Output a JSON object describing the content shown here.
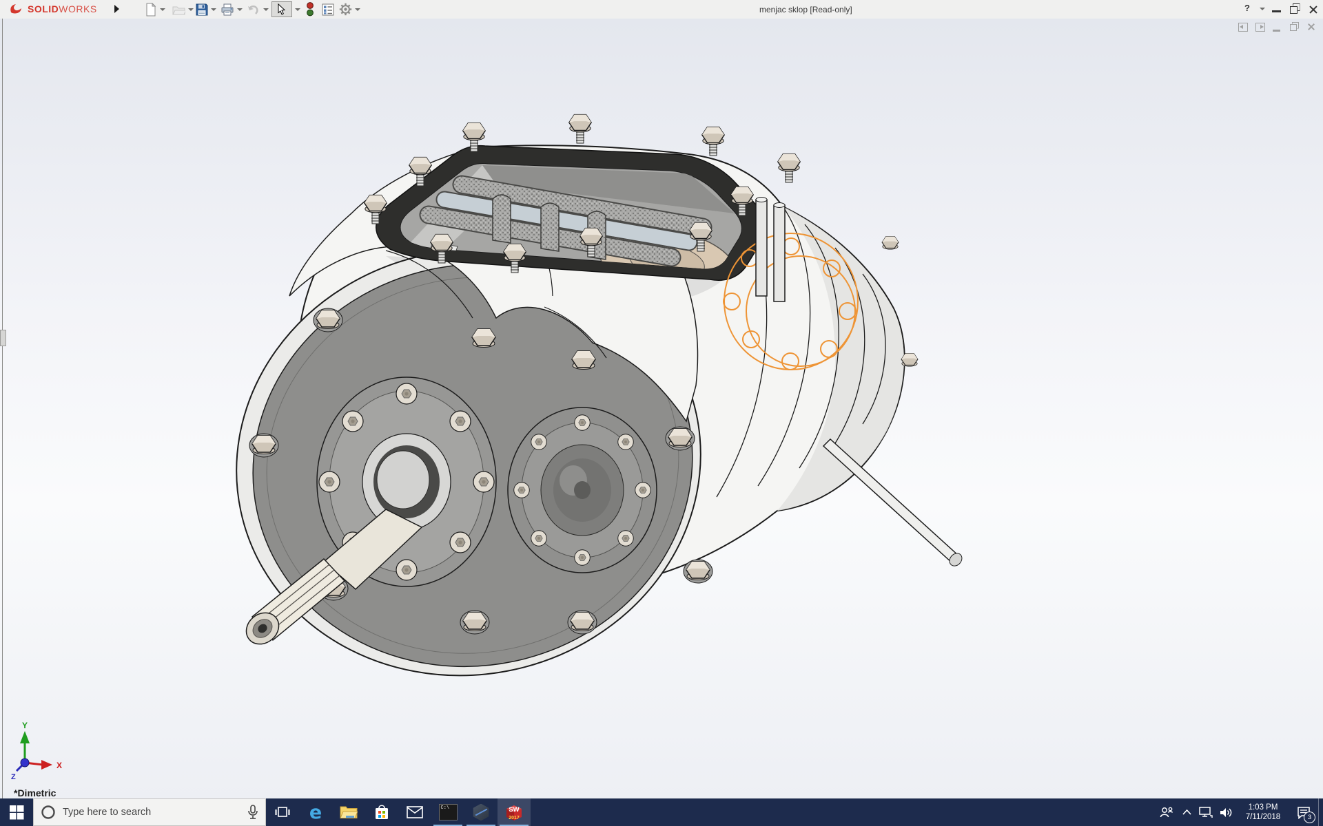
{
  "window": {
    "brand": {
      "solid": "SOLID",
      "works": "WORKS"
    },
    "title": "menjac sklop [Read-only]",
    "help_label": "?"
  },
  "toolbar": {
    "icons": [
      "new-document",
      "open",
      "save",
      "print",
      "undo",
      "select",
      "rebuild-traffic-light",
      "file-properties",
      "options"
    ]
  },
  "viewport": {
    "orientation_label": "*Dimetric",
    "triad": {
      "x_label": "X",
      "y_label": "Y",
      "z_label": "Z",
      "x_color": "#cc2020",
      "y_color": "#1f9d1f",
      "z_color": "#2a2ab8"
    },
    "sketch_color": "#ee9435"
  },
  "taskbar": {
    "search": {
      "placeholder": "Type here to search"
    },
    "apps": [
      {
        "name": "task-view"
      },
      {
        "name": "edge",
        "glyph": "e"
      },
      {
        "name": "file-explorer"
      },
      {
        "name": "store"
      },
      {
        "name": "mail"
      },
      {
        "name": "command-prompt",
        "icon_text": "C:\\"
      },
      {
        "name": "hexagon-app"
      },
      {
        "name": "solidworks-2017",
        "label": "SW",
        "year": "2017"
      }
    ],
    "tray": {
      "time": "1:03 PM",
      "date": "7/11/2018",
      "notification_count": "3"
    },
    "colors": {
      "taskbar_bg": "#1d2b4d",
      "accent_underline": "#8ab6e0"
    }
  }
}
